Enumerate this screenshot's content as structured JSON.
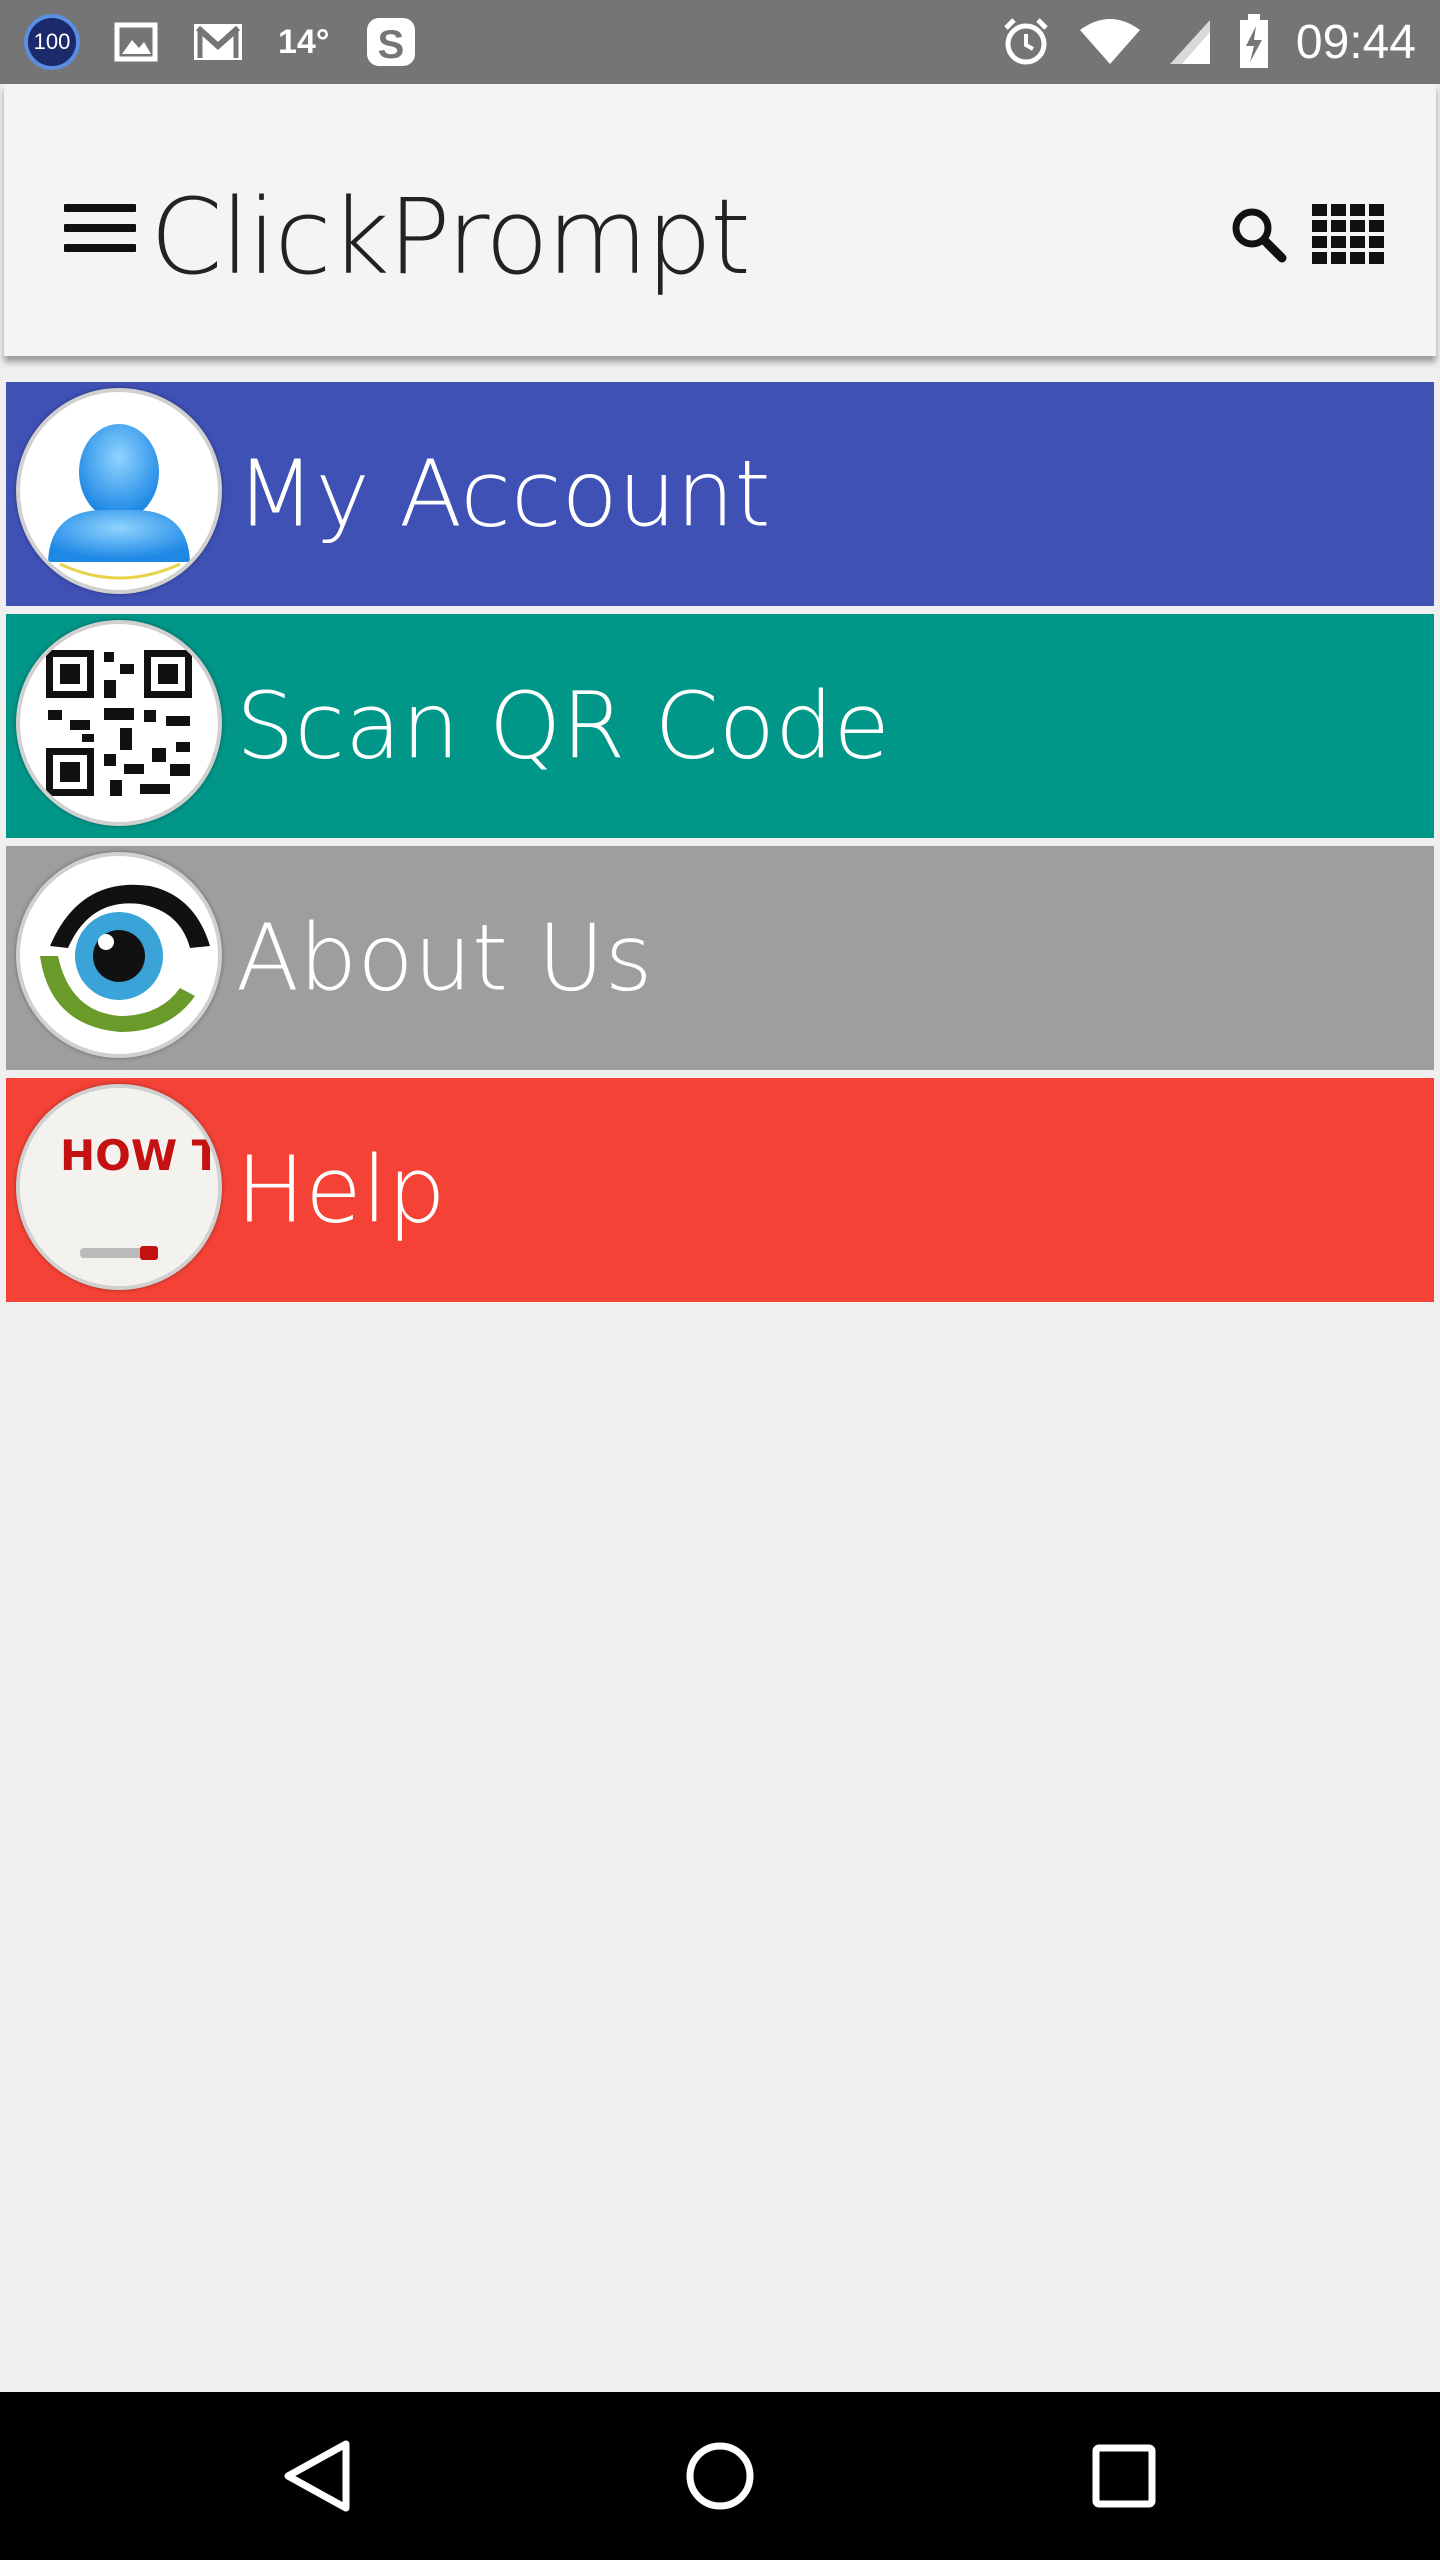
{
  "status_bar": {
    "badge_text": "100",
    "temperature": "14°",
    "time": "09:44",
    "icons_left": [
      "notification-count-badge",
      "image-icon",
      "gmail-icon",
      "temperature-indicator",
      "skype-icon"
    ],
    "icons_right": [
      "alarm-icon",
      "wifi-icon",
      "signal-icon",
      "battery-charging-icon"
    ]
  },
  "app_bar": {
    "title": "ClickPrompt",
    "icons": [
      "menu-icon",
      "search-icon",
      "grid-icon"
    ]
  },
  "menu": {
    "items": [
      {
        "label": "My Account",
        "color": "#3f51b5",
        "icon": "user-icon"
      },
      {
        "label": "Scan QR Code",
        "color": "#009688",
        "icon": "qr-code-icon"
      },
      {
        "label": "About Us",
        "color": "#9e9e9e",
        "icon": "eye-icon"
      },
      {
        "label": "Help",
        "color": "#f44336",
        "icon": "how-to-icon",
        "icon_text": "HOW TO..."
      }
    ]
  },
  "nav_bar": {
    "buttons": [
      "back-button",
      "home-button",
      "recents-button"
    ]
  }
}
